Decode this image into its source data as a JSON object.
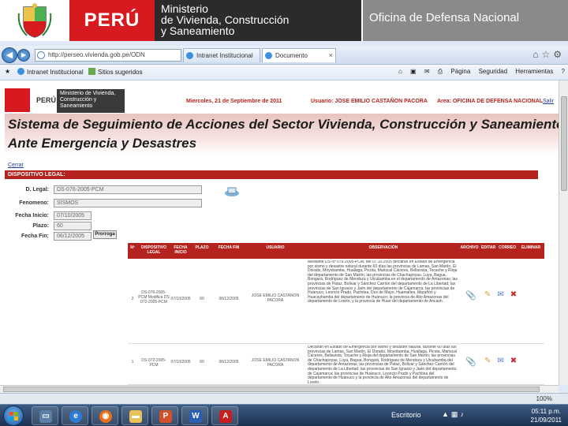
{
  "slide_header": {
    "peru": "PERÚ",
    "ministry_line1": "Ministerio",
    "ministry_line2": "de Vivienda, Construcción",
    "ministry_line3": "y Saneamiento",
    "office": "Oficina de Defensa Nacional"
  },
  "browser": {
    "url": "http://perseo.vivienda.gob.pe/ODN",
    "tabs": [
      {
        "label": "Intranet Institucional",
        "active": false
      },
      {
        "label": "Documento",
        "active": true
      }
    ],
    "favorites": [
      {
        "label": "Intranet Institucional"
      },
      {
        "label": "Sitios sugeridos"
      }
    ],
    "toolbar": {
      "page": "Página",
      "safety": "Seguridad",
      "tools": "Herramientas"
    },
    "zoom": "100%"
  },
  "site": {
    "peru": "PERÚ",
    "ministry": "Ministerio de Vivienda, Construcción y Saneamiento",
    "date": "Miercoles, 21 de Septiembre de 2011",
    "user": "Usuario: JOSE EMILIO CASTAÑON PACORA",
    "area": "Area: OFICINA DE DEFENSA NACIONAL",
    "logout": "Salir",
    "banner_line1": "Sistema de Seguimiento de Acciones del Sector Vivienda, Construcción y Saneamiento",
    "banner_line2": "Ante Emergencia y Desastres",
    "close_link": "Cerrar",
    "section_title": "DISPOSITIVO LEGAL:"
  },
  "form": {
    "fields": [
      {
        "label": "D. Legal:",
        "value": "DS-076-2005-PCM"
      },
      {
        "label": "Fenomeno:",
        "value": "SISMOS"
      },
      {
        "label": "Fecha Inicio:",
        "value": "07/10/2005"
      },
      {
        "label": "Plazo:",
        "value": "60"
      },
      {
        "label": "Fecha Fin:",
        "value": "06/12/2005"
      }
    ],
    "prorroga_button": "Prorroga"
  },
  "table": {
    "headers": [
      "Nº",
      "DISPOSITIVO LEGAL",
      "FECHA INICIO",
      "PLAZO",
      "FECHA FIN",
      "USUARIO",
      "OBSERVACIÓN",
      "ARCHIVO",
      "EDITAR",
      "CORREO",
      "ELIMINAR"
    ],
    "rows": [
      {
        "num": "2",
        "legal": "DS-076-2005-PCM Modifica DS 072-2005-PCM",
        "start": "07/10/2005",
        "term": "60",
        "end": "06/12/2005",
        "user": "JOSE EMILIO CASTAÑON PACORA",
        "observation": "Mediante DS Nº 076-2005-PCM, del 07.10.2005 declaran en Estado de Emergencia por sismo y desastre natural durante 60 días las provincias de Lamas, San Martín, El Dorado, Moyobamba, Huallaga, Picota, Mariscal Cáceres, Bellavista, Tocache y Rioja del departamento de San Martín; las provincias de Chachapoyas, Luya, Bagua, Bongará, Rodríguez de Mendoza y Utcubamba en el departamento de Amazonas; las provincias de Pataz, Bolívar y Sánchez Carrión del departamento de La Libertad; las provincias de San Ignacio y Jaén del departamento de Cajamarca; las provincias de Huánuco, Leoncio Prado, Pachitea, Dos de Mayo, Huamalíes, Marañón y Huacaybamba del departamento de Huánuco; la provincia de Alto Amazonas del departamento de Loreto; y la provincia de Huari del departamento de Ancash."
      },
      {
        "num": "1",
        "legal": "DS-072-2005-PCM",
        "start": "07/10/2005",
        "term": "60",
        "end": "06/12/2005",
        "user": "JOSE EMILIO CASTAÑON PACORA",
        "observation": "Declaran en Estado de Emergencia por sismo y desastre natural, durante 60 días las provincias de Lamas, San Martín, El Dorado, Moyobamba, Huallaga, Picota, Mariscal Cáceres, Bellavista, Tocache y Rioja del departamento de San Martín; las provincias de Chachapoyas, Luya, Bagua, Bongará, Rodríguez de Mendoza y Utcubamba del departamento de Amazonas; las provincias de Pataz, Bolívar y Sánchez Carrión del departamento de La Libertad; las provincias de San Ignacio y Jaén del departamento de Cajamarca; las provincias de Huánuco, Leoncio Prado y Pachitea del departamento de Huánuco y la provincia de Alto Amazonas del departamento de Loreto."
      }
    ]
  },
  "taskbar": {
    "escritorio": "Escritorio",
    "time": "05:11 p.m.",
    "date": "21/09/2011"
  },
  "colors": {
    "brand_red": "#d71920",
    "table_red": "#b4231e"
  }
}
